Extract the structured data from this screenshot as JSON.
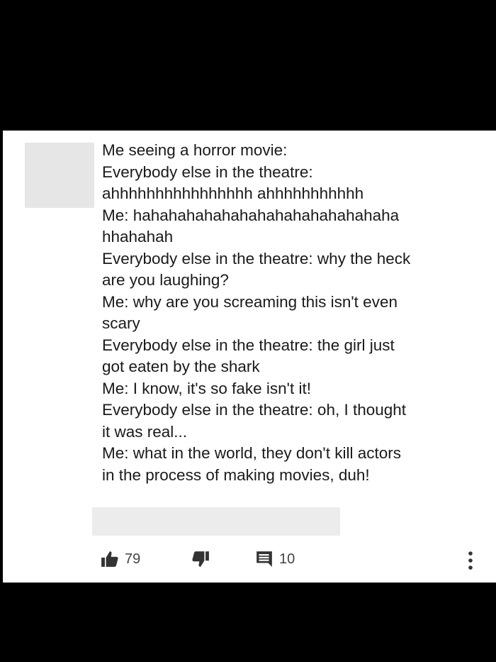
{
  "comment": {
    "lines": [
      "Me seeing a horror movie:",
      "Everybody else in the theatre:",
      "ahhhhhhhhhhhhhhhh ahhhhhhhhhhh",
      "Me: hahahahahahahahahahahahahahaha",
      "hhahahah",
      "Everybody else in the theatre: why the heck",
      "are you laughing?",
      "Me: why are you screaming this isn't even",
      "scary",
      "Everybody else in the theatre: the girl just",
      "got eaten by the shark",
      "Me: I know, it's so fake isn't it!",
      "Everybody else in the theatre: oh, I thought",
      "it was real...",
      "Me: what in the world, they don't kill actors",
      "in the process of making movies, duh!"
    ]
  },
  "actions": {
    "likes": "79",
    "replies": "10"
  },
  "icons": {
    "like": "thumbs-up-icon",
    "dislike": "thumbs-down-icon",
    "reply": "comment-icon",
    "more": "more-vertical-icon"
  },
  "colors": {
    "background": "#000000",
    "card": "#ffffff",
    "redacted": "#e6e6e6",
    "text": "#1a1a1a",
    "icon": "#333333"
  }
}
